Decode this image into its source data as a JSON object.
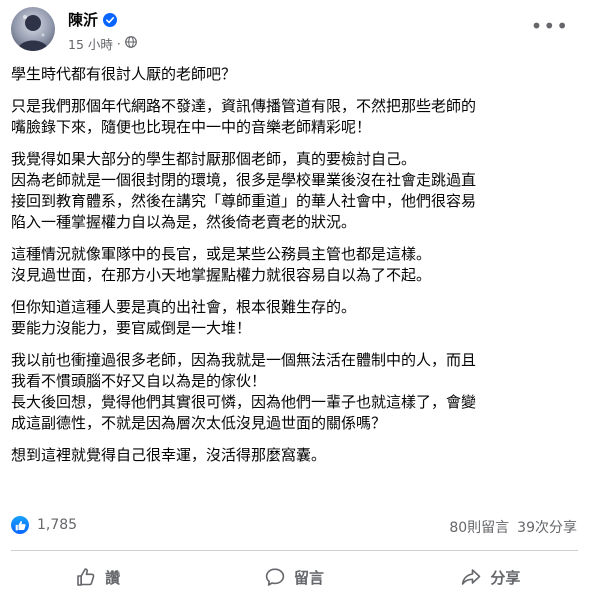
{
  "post": {
    "author": "陳沂",
    "time": "15 小時",
    "paragraphs": [
      [
        "學生時代都有很討人厭的老師吧？"
      ],
      [
        "只是我們那個年代網路不發達，資訊傳播管道有限，不然把那些老師的",
        "嘴臉錄下來，隨便也比現在中一中的音樂老師精彩呢！"
      ],
      [
        "我覺得如果大部分的學生都討厭那個老師，真的要檢討自己。",
        "因為老師就是一個很封閉的環境，很多是學校畢業後沒在社會走跳過直",
        "接回到教育體系，然後在講究「尊師重道」的華人社會中，他們很容易",
        "陷入一種掌握權力自以為是，然後倚老賣老的狀況。"
      ],
      [
        "這種情況就像軍隊中的長官，或是某些公務員主管也都是這樣。",
        "沒見過世面，在那方小天地掌握點權力就很容易自以為了不起。"
      ],
      [
        "但你知道這種人要是真的出社會，根本很難生存的。",
        "要能力沒能力，要官威倒是一大堆！"
      ],
      [
        "我以前也衝撞過很多老師，因為我就是一個無法活在體制中的人，而且",
        "我看不慣頭腦不好又自以為是的傢伙！",
        "長大後回想，覺得他們其實很可憐，因為他們一輩子也就這樣了，會變",
        "成這副德性，不就是因為層次太低沒見過世面的關係嗎？"
      ],
      [
        "想到這裡就覺得自己很幸運，沒活得那麼窩囊。"
      ]
    ],
    "reaction_count": "1,785",
    "comments": "80則留言",
    "shares": "39次分享"
  },
  "actions": {
    "like": "讚",
    "comment": "留言",
    "share": "分享"
  },
  "colors": {
    "text": "#050505",
    "secondary": "#65676b",
    "brand_blue": "#0866ff",
    "divider": "#ced0d4"
  },
  "icons": [
    "verified-badge-icon",
    "globe-icon",
    "more-options-icon",
    "like-reaction-icon",
    "thumbs-up-icon",
    "comment-icon",
    "share-icon"
  ]
}
